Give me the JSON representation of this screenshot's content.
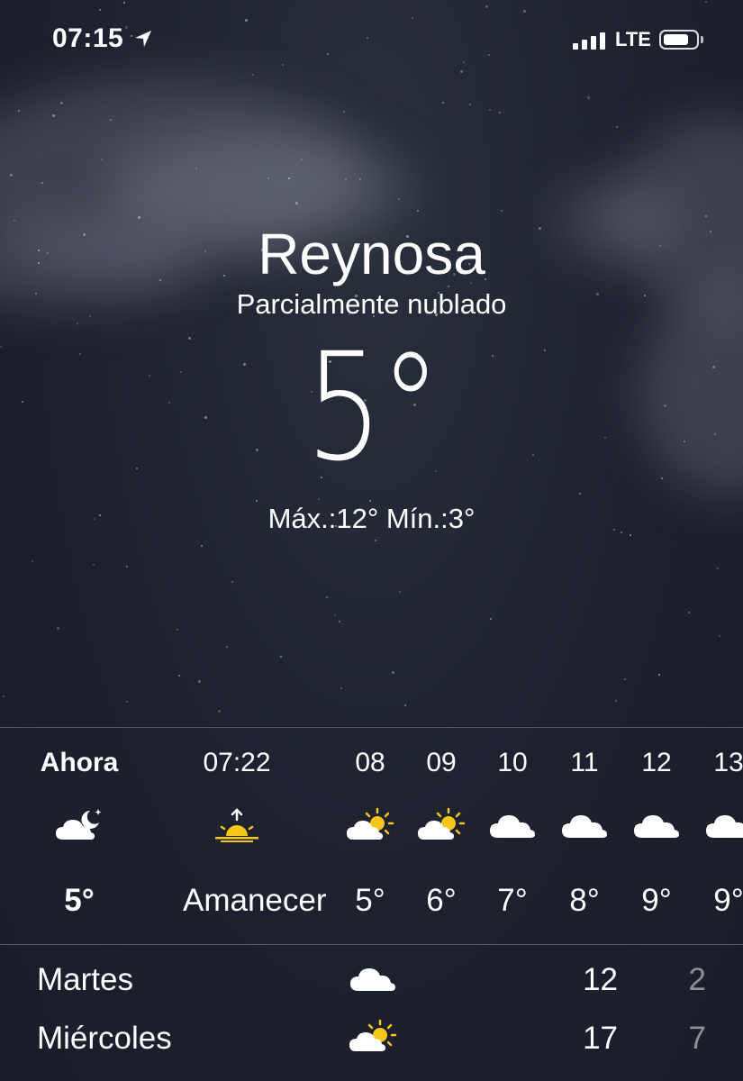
{
  "status_bar": {
    "time": "07:15",
    "location_icon": "location-arrow-icon",
    "network": "LTE",
    "signal_bars": 4,
    "battery_level": 0.8
  },
  "header": {
    "city": "Reynosa",
    "condition": "Parcialmente nublado",
    "temperature": "5°",
    "high_low": "Máx.:12° Mín.:3°"
  },
  "hourly": [
    {
      "label": "Ahora",
      "icon": "moon-cloud-icon",
      "temp": "5°"
    },
    {
      "label": "07:22",
      "icon": "sunrise-icon",
      "temp": "Amanecer"
    },
    {
      "label": "08",
      "icon": "sun-cloud-icon",
      "temp": "5°"
    },
    {
      "label": "09",
      "icon": "sun-cloud-icon",
      "temp": "6°"
    },
    {
      "label": "10",
      "icon": "cloud-icon",
      "temp": "7°"
    },
    {
      "label": "11",
      "icon": "cloud-icon",
      "temp": "8°"
    },
    {
      "label": "12",
      "icon": "cloud-icon",
      "temp": "9°"
    },
    {
      "label": "13",
      "icon": "cloud-icon",
      "temp": "9°"
    }
  ],
  "daily": [
    {
      "day": "Martes",
      "icon": "cloud-icon",
      "high": "12",
      "low": "2"
    },
    {
      "day": "Miércoles",
      "icon": "sun-cloud-icon",
      "high": "17",
      "low": "7"
    }
  ],
  "colors": {
    "background": "#1c1f2b",
    "text": "#ffffff",
    "sun": "#f5c518",
    "muted_text": "#8a8d96"
  }
}
